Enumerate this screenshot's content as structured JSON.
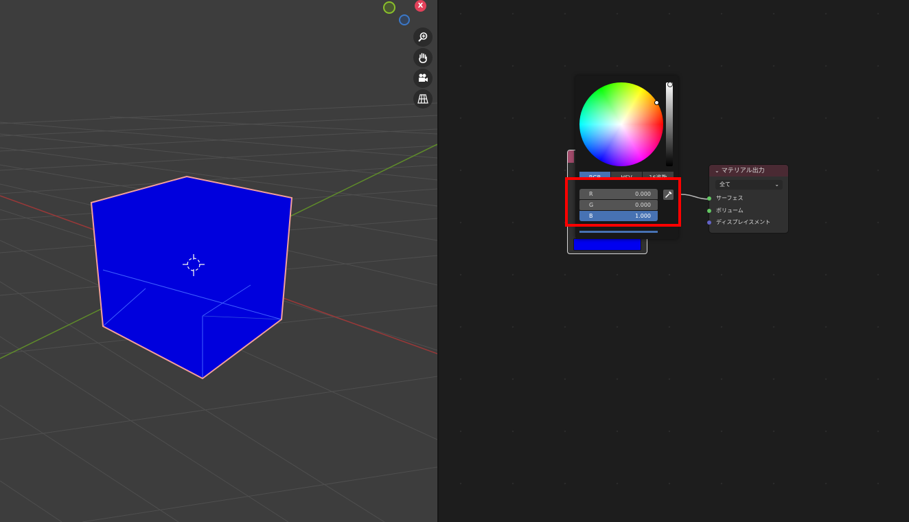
{
  "viewport": {
    "gizmo": {
      "x_label": "X"
    },
    "nav_tools": [
      "zoom-icon",
      "hand-pan-icon",
      "camera-icon",
      "grid-perspective-icon"
    ],
    "cube_color": "#0000dd",
    "outline_color": "#f4a09a"
  },
  "node_editor": {
    "color_picker": {
      "tabs": [
        "RGB",
        "HSV",
        "16進数"
      ],
      "active_tab": "RGB",
      "fields": [
        {
          "label": "R",
          "value": "0.000"
        },
        {
          "label": "G",
          "value": "0.000"
        },
        {
          "label": "B",
          "value": "1.000"
        }
      ],
      "highlight_color": "#ff0000",
      "current_color": "#0000f0"
    },
    "output_node": {
      "title": "マテリアル出力",
      "target": "全て",
      "sockets": [
        {
          "label": "サーフェス",
          "color": "#63c763"
        },
        {
          "label": "ボリューム",
          "color": "#63c763"
        },
        {
          "label": "ディスプレイスメント",
          "color": "#6363c7"
        }
      ]
    }
  }
}
